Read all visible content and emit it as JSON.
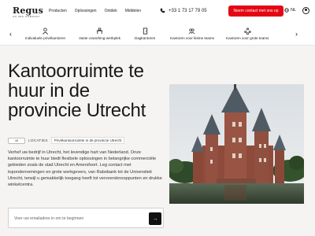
{
  "header": {
    "logo": "Regus",
    "logo_sub": "AN IWG COMPANY",
    "nav": [
      "Producten",
      "Oplossingen",
      "Ontdek",
      "Middelen"
    ],
    "phone": "+33 1 73 17 79 05",
    "contact_label": "Neem contact met ons op",
    "language": "NL"
  },
  "categories": [
    "Individuele privékantoren",
    "Vaste coworking-werkplek",
    "Dagkantoren",
    "Kantoren voor kleine teams",
    "Kantoren voor grote teams"
  ],
  "hero": {
    "title": "Kantoorruimte te huur in de provincie Utrecht",
    "location_count": "48",
    "location_label": "LOCATIES",
    "location_select": "Privékantoorruimte in de provincie Utrecht",
    "description": "Verhef uw bedrijf in Utrecht, het levendige hart van Nederland. Onze kantoorruimte te huur biedt flexibele oplossingen in belangrijke commerciële gebieden zoals de stad Utrecht en Amersfoort. Leg contact met topondernemingen en grote werkgevers, van Rabobank tot de Universiteit Utrecht, terwijl u gemakkelijk toegang heeft tot vervoersknooppunten en drukke winkelcentra.",
    "email_placeholder": "Voer uw emailadres in om te beginnen"
  },
  "colors": {
    "accent": "#e30613",
    "hero_bg": "#f5f4f2"
  },
  "icons": {
    "phone": "phone-icon",
    "globe": "globe-icon",
    "user": "user-icon",
    "arrow": "arrow-right-icon"
  }
}
